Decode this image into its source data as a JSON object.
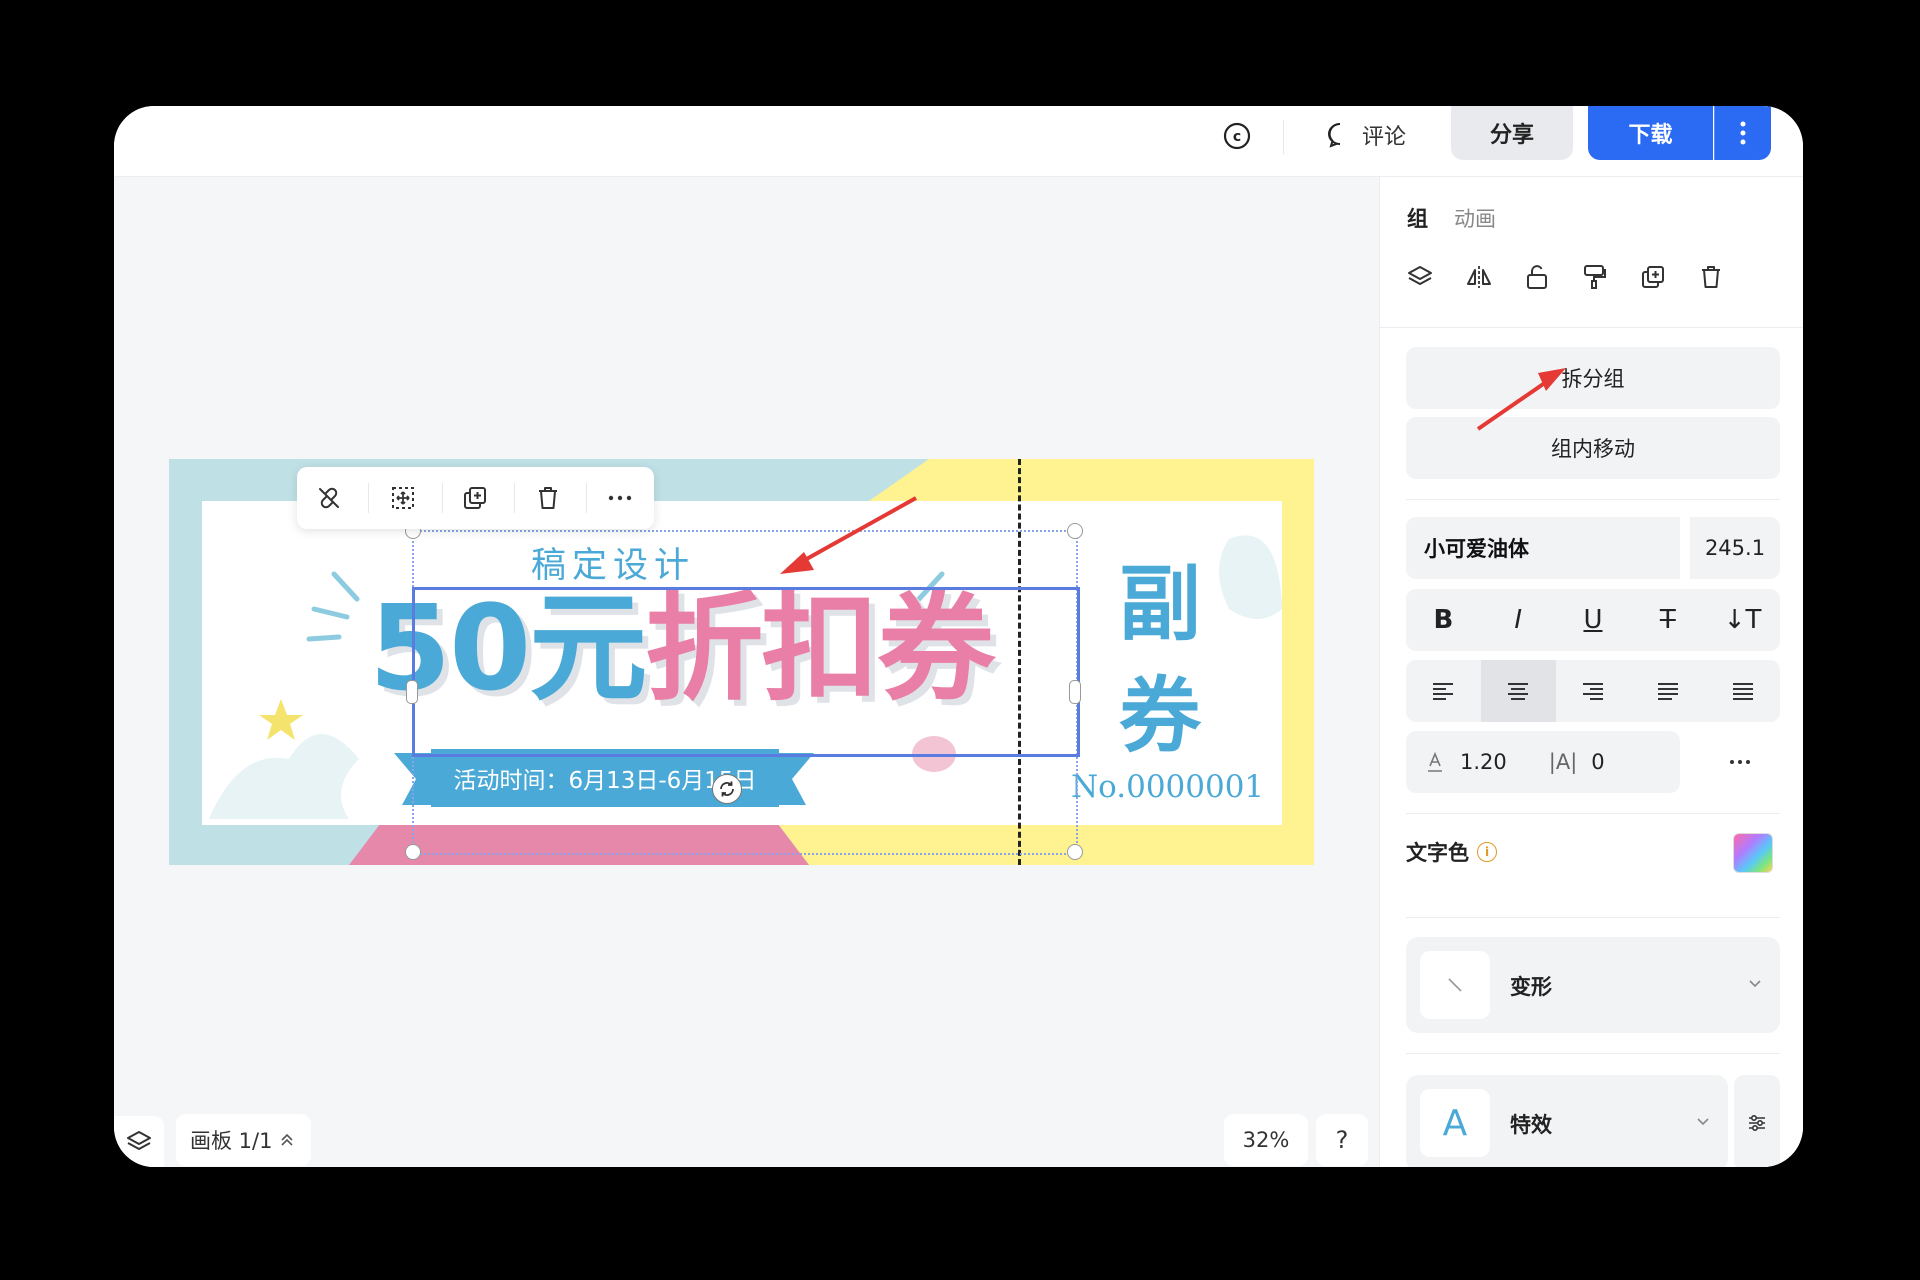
{
  "topbar": {
    "comment_label": "评论",
    "share_label": "分享",
    "download_label": "下载"
  },
  "floating_toolbar": {
    "icons": [
      "unlink-icon",
      "select-move-icon",
      "duplicate-icon",
      "delete-icon",
      "more-icon"
    ]
  },
  "coupon": {
    "subtitle": "稿定设计",
    "title_blue": "50元",
    "title_pink": "折扣券",
    "event_time": "活动时间：6月13日-6月15日",
    "stub_title": "副券",
    "serial_no": "No.0000001",
    "colors": {
      "blue": "#4aa9d6",
      "pink": "#e97fa6",
      "teal_bg": "#bfe1e6",
      "yellow_bg": "#fff291"
    }
  },
  "bottom": {
    "board_label": "画板 1/1",
    "zoom": "32%",
    "help": "?"
  },
  "right_panel": {
    "tab_group": "组",
    "tab_animation": "动画",
    "tool_icons": [
      "layers-icon",
      "flip-icon",
      "lock-icon",
      "format-painter-icon",
      "duplicate-icon",
      "delete-icon"
    ],
    "ungroup_button": "拆分组",
    "move_in_group_button": "组内移动",
    "font_name": "小可爱油体",
    "font_size": "245.1",
    "style_buttons": [
      "B",
      "I",
      "U",
      "T",
      "↓T"
    ],
    "line_height": "1.20",
    "letter_spacing": "0",
    "text_color_label": "文字色",
    "transform_label": "变形",
    "effects_label": "特效"
  }
}
